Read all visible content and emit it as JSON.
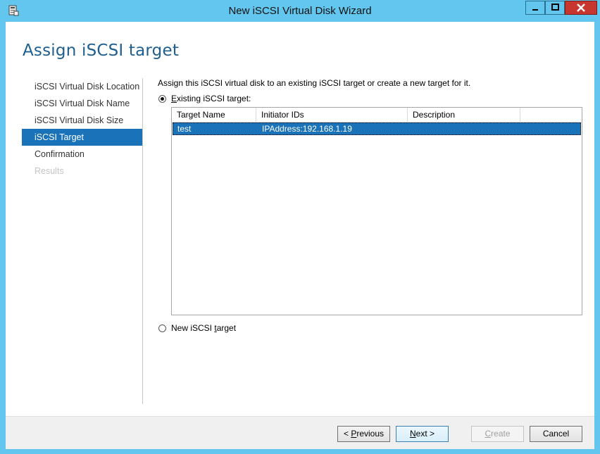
{
  "window": {
    "title": "New iSCSI Virtual Disk Wizard",
    "icon": "server-manager-icon"
  },
  "header": {
    "title": "Assign iSCSI target"
  },
  "nav": {
    "items": [
      {
        "label": "iSCSI Virtual Disk Location",
        "state": "normal"
      },
      {
        "label": "iSCSI Virtual Disk Name",
        "state": "normal"
      },
      {
        "label": "iSCSI Virtual Disk Size",
        "state": "normal"
      },
      {
        "label": "iSCSI Target",
        "state": "active"
      },
      {
        "label": "Confirmation",
        "state": "normal"
      },
      {
        "label": "Results",
        "state": "disabled"
      }
    ]
  },
  "main": {
    "description": "Assign this iSCSI virtual disk to an existing iSCSI target or create a new target for it.",
    "existing_option": {
      "label_prefix": "",
      "label_accel": "E",
      "label_rest": "xisting iSCSI target:",
      "checked": true
    },
    "new_option": {
      "label_prefix": "New iSCSI ",
      "label_accel": "t",
      "label_rest": "arget",
      "checked": false
    },
    "table": {
      "columns": [
        "Target Name",
        "Initiator IDs",
        "Description",
        ""
      ],
      "rows": [
        {
          "target_name": "test",
          "initiator_ids": "IPAddress:192.168.1.19",
          "description": "",
          "selected": true
        }
      ]
    }
  },
  "footer": {
    "previous": {
      "prefix": "< ",
      "accel": "P",
      "rest": "revious"
    },
    "next": {
      "prefix": "",
      "accel": "N",
      "rest": "ext >"
    },
    "create": {
      "prefix": "",
      "accel": "C",
      "rest": "reate"
    },
    "cancel": {
      "label": "Cancel"
    }
  },
  "colors": {
    "titlebar": "#62c6ee",
    "accent": "#1a73b8",
    "header_title": "#1f5f8f",
    "close_button": "#c7372f"
  }
}
